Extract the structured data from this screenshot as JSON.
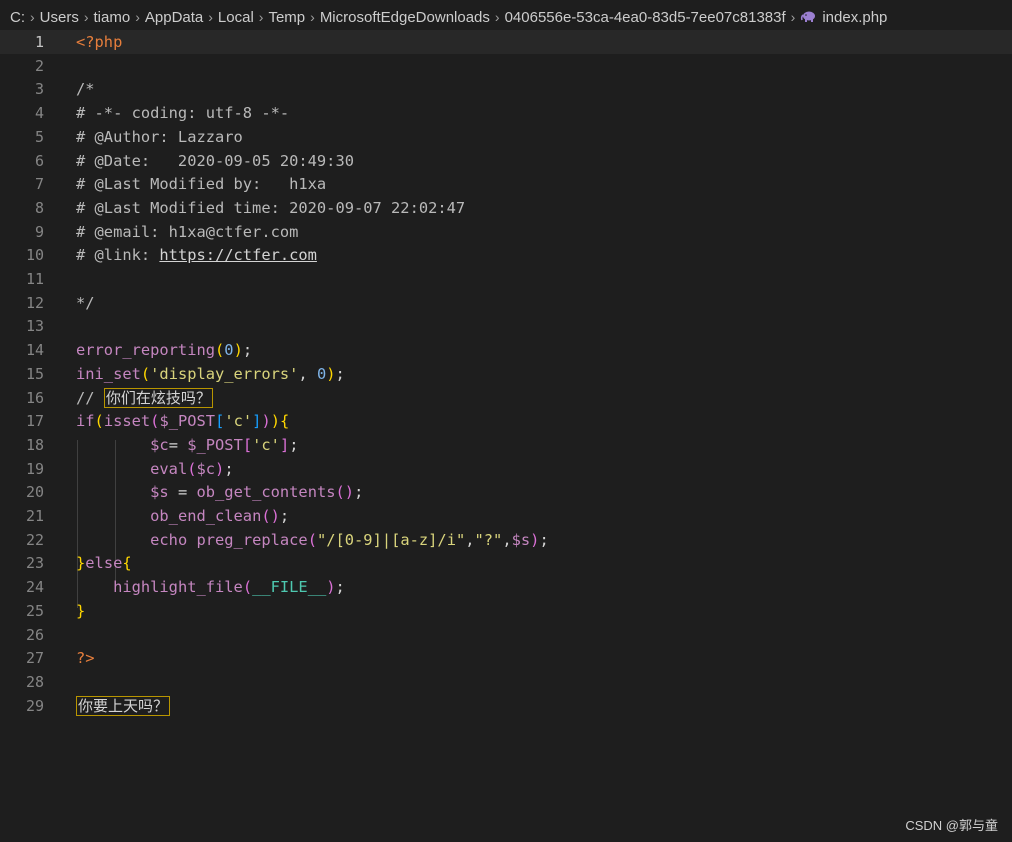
{
  "breadcrumb": {
    "items": [
      "C:",
      "Users",
      "tiamo",
      "AppData",
      "Local",
      "Temp",
      "MicrosoftEdgeDownloads",
      "0406556e-53ca-4ea0-83d5-7ee07c81383f",
      "index.php"
    ],
    "file_icon": "php-elephant-icon"
  },
  "editor": {
    "current_line": 1,
    "lines": [
      [
        {
          "t": "<?php",
          "c": "tag"
        }
      ],
      [],
      [
        {
          "t": "/*",
          "c": "com"
        }
      ],
      [
        {
          "t": "# -*- coding: utf-8 -*-",
          "c": "com"
        }
      ],
      [
        {
          "t": "# @Author: Lazzaro",
          "c": "com"
        }
      ],
      [
        {
          "t": "# @Date:   2020-09-05 20:49:30",
          "c": "com"
        }
      ],
      [
        {
          "t": "# @Last Modified by:   h1xa",
          "c": "com"
        }
      ],
      [
        {
          "t": "# @Last Modified time: 2020-09-07 22:02:47",
          "c": "com"
        }
      ],
      [
        {
          "t": "# @email: h1xa@ctfer.com",
          "c": "com"
        }
      ],
      [
        {
          "t": "# @link: ",
          "c": "com"
        },
        {
          "t": "https://ctfer.com",
          "c": "link"
        }
      ],
      [],
      [
        {
          "t": "*/",
          "c": "com"
        }
      ],
      [],
      [
        {
          "t": "error_reporting",
          "c": "fn"
        },
        {
          "t": "(",
          "c": "p1"
        },
        {
          "t": "0",
          "c": "num"
        },
        {
          "t": ")",
          "c": "p1"
        },
        {
          "t": ";",
          "c": "op"
        }
      ],
      [
        {
          "t": "ini_set",
          "c": "fn"
        },
        {
          "t": "(",
          "c": "p1"
        },
        {
          "t": "'display_errors'",
          "c": "str"
        },
        {
          "t": ", ",
          "c": "op"
        },
        {
          "t": "0",
          "c": "num"
        },
        {
          "t": ")",
          "c": "p1"
        },
        {
          "t": ";",
          "c": "op"
        }
      ],
      [
        {
          "t": "// ",
          "c": "com"
        },
        {
          "t": "你们在炫技吗？",
          "c": "cjk"
        }
      ],
      [
        {
          "t": "if",
          "c": "key"
        },
        {
          "t": "(",
          "c": "p1"
        },
        {
          "t": "isset",
          "c": "fn"
        },
        {
          "t": "(",
          "c": "p2"
        },
        {
          "t": "$_POST",
          "c": "var"
        },
        {
          "t": "[",
          "c": "p3"
        },
        {
          "t": "'c'",
          "c": "str"
        },
        {
          "t": "]",
          "c": "p3"
        },
        {
          "t": ")",
          "c": "p2"
        },
        {
          "t": ")",
          "c": "p1"
        },
        {
          "t": "{",
          "c": "p1"
        }
      ],
      [
        {
          "t": "        ",
          "c": "op"
        },
        {
          "t": "$c",
          "c": "var"
        },
        {
          "t": "= ",
          "c": "op"
        },
        {
          "t": "$_POST",
          "c": "var"
        },
        {
          "t": "[",
          "c": "p2"
        },
        {
          "t": "'c'",
          "c": "str"
        },
        {
          "t": "]",
          "c": "p2"
        },
        {
          "t": ";",
          "c": "op"
        }
      ],
      [
        {
          "t": "        ",
          "c": "op"
        },
        {
          "t": "eval",
          "c": "fn"
        },
        {
          "t": "(",
          "c": "p2"
        },
        {
          "t": "$c",
          "c": "var"
        },
        {
          "t": ")",
          "c": "p2"
        },
        {
          "t": ";",
          "c": "op"
        }
      ],
      [
        {
          "t": "        ",
          "c": "op"
        },
        {
          "t": "$s",
          "c": "var"
        },
        {
          "t": " = ",
          "c": "op"
        },
        {
          "t": "ob_get_contents",
          "c": "fn"
        },
        {
          "t": "(",
          "c": "p2"
        },
        {
          "t": ")",
          "c": "p2"
        },
        {
          "t": ";",
          "c": "op"
        }
      ],
      [
        {
          "t": "        ",
          "c": "op"
        },
        {
          "t": "ob_end_clean",
          "c": "fn"
        },
        {
          "t": "(",
          "c": "p2"
        },
        {
          "t": ")",
          "c": "p2"
        },
        {
          "t": ";",
          "c": "op"
        }
      ],
      [
        {
          "t": "        ",
          "c": "op"
        },
        {
          "t": "echo ",
          "c": "key"
        },
        {
          "t": "preg_replace",
          "c": "fn"
        },
        {
          "t": "(",
          "c": "p2"
        },
        {
          "t": "\"/[0-9]|[a-z]/i\"",
          "c": "str"
        },
        {
          "t": ",",
          "c": "op"
        },
        {
          "t": "\"?\"",
          "c": "str"
        },
        {
          "t": ",",
          "c": "op"
        },
        {
          "t": "$s",
          "c": "var"
        },
        {
          "t": ")",
          "c": "p2"
        },
        {
          "t": ";",
          "c": "op"
        }
      ],
      [
        {
          "t": "}",
          "c": "p1"
        },
        {
          "t": "else",
          "c": "key"
        },
        {
          "t": "{",
          "c": "p1"
        }
      ],
      [
        {
          "t": "    ",
          "c": "op"
        },
        {
          "t": "highlight_file",
          "c": "fn"
        },
        {
          "t": "(",
          "c": "p2"
        },
        {
          "t": "__FILE__",
          "c": "const"
        },
        {
          "t": ")",
          "c": "p2"
        },
        {
          "t": ";",
          "c": "op"
        }
      ],
      [
        {
          "t": "}",
          "c": "p1"
        }
      ],
      [],
      [
        {
          "t": "?>",
          "c": "tag"
        }
      ],
      [],
      [
        {
          "t": "你要上天吗？",
          "c": "cjk"
        }
      ]
    ]
  },
  "watermark": "CSDN @郭与童"
}
